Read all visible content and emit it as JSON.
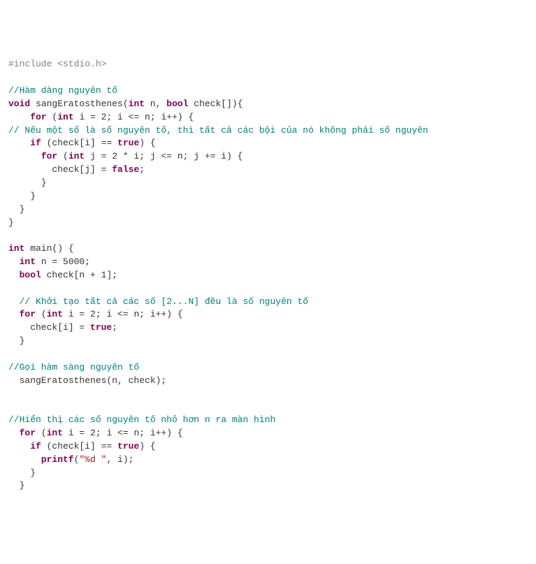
{
  "code": {
    "l1_include": "#include <stdio.h>",
    "l3_cm": "//Hàm dàng nguyên tố",
    "l4_void": "void",
    "l4_fn": " sangEratosthenes(",
    "l4_int": "int",
    "l4_n": " n, ",
    "l4_bool": "bool",
    "l4_chk": " check[]){",
    "l5_for": "for",
    "l5_op": " (",
    "l5_int": "int",
    "l5_body": " i = 2; i <= n; i++) {",
    "l6_cm": "// Nếu một số là số nguyên tố, thì tất cả các bội của nó không phải số nguyên",
    "l7_if": "if",
    "l7_body1": " (check[i] == ",
    "l7_true": "true",
    "l7_body2": ") {",
    "l8_for": "for",
    "l8_op": " (",
    "l8_int": "int",
    "l8_body": " j = 2 * i; j <= n; j += i) {",
    "l9_body1": "        check[j] = ",
    "l9_false": "false",
    "l9_body2": ";",
    "l15_int": "int",
    "l15_main": " main() {",
    "l16_int": "int",
    "l16_body": " n = 5000;",
    "l17_bool": "bool",
    "l17_body": " check[n + 1];",
    "l19_cm": "// Khởi tạo tất cả các số [2...N] đều là số nguyên tố",
    "l20_for": "for",
    "l20_op": " (",
    "l20_int": "int",
    "l20_body": " i = 2; i <= n; i++) {",
    "l21_body1": "    check[i] = ",
    "l21_true": "true",
    "l21_body2": ";",
    "l24_cm": "//Gọi hàm sàng nguyên tố",
    "l25_call": "  sangEratosthenes(n, check);",
    "l28_cm": "//Hiển thị các số nguyên tố nhỏ hơn n ra màn hình",
    "l29_for": "for",
    "l29_op": " (",
    "l29_int": "int",
    "l29_body": " i = 2; i <= n; i++) {",
    "l30_if": "if",
    "l30_body1": " (check[i] == ",
    "l30_true": "true",
    "l30_body2": ") {",
    "l31_printf": "printf",
    "l31_op1": "(",
    "l31_str": "\"%d \"",
    "l31_op2": ", i);",
    "brace_close": "}",
    "brace_close2": "  }",
    "brace_close4": "    }",
    "brace_close6": "      }"
  }
}
